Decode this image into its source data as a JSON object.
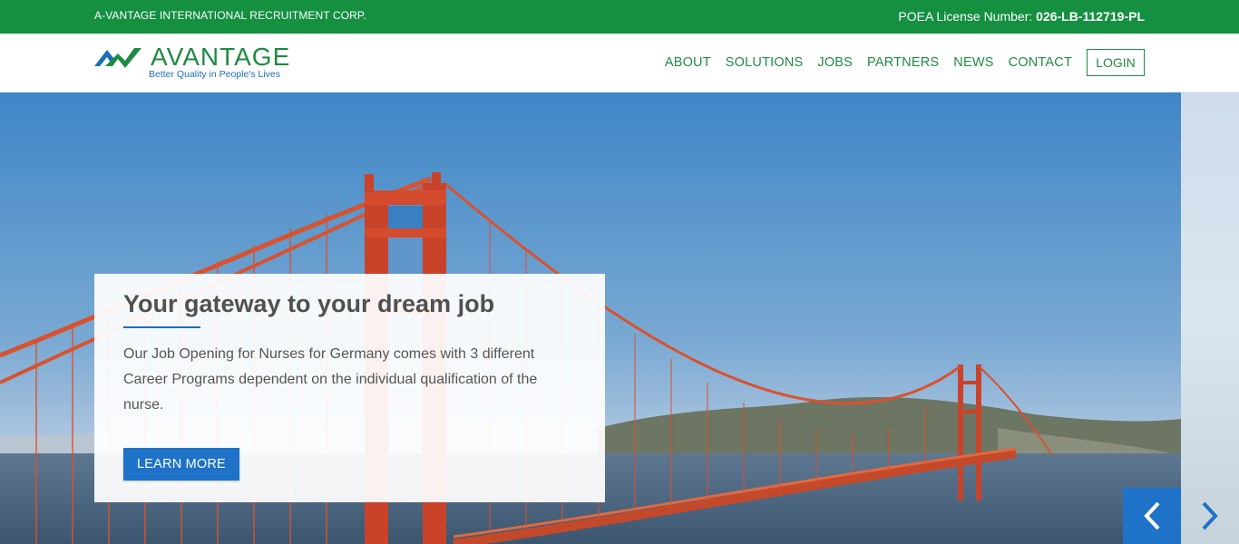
{
  "topbar": {
    "company": "A-VANTAGE INTERNATIONAL RECRUITMENT CORP.",
    "license_label": "POEA License Number: ",
    "license_number": "026-LB-112719-PL"
  },
  "logo": {
    "wordmark": "AVANTAGE",
    "tagline": "Better Quality in People's Lives"
  },
  "nav": {
    "items": [
      {
        "label": "ABOUT"
      },
      {
        "label": "SOLUTIONS"
      },
      {
        "label": "JOBS"
      },
      {
        "label": "PARTNERS"
      },
      {
        "label": "NEWS"
      },
      {
        "label": "CONTACT"
      }
    ],
    "login": "LOGIN"
  },
  "hero": {
    "title": "Your gateway to your dream job",
    "body": "Our Job Opening for Nurses for Germany comes with 3 different Career Programs dependent on the individual qualification of the nurse.",
    "cta": "LEARN MORE"
  },
  "colors": {
    "brand_green": "#149040",
    "brand_blue": "#1e73c8",
    "bridge_red": "#d9522f"
  },
  "icons": {
    "prev": "chevron-left-icon",
    "next": "chevron-right-icon"
  }
}
